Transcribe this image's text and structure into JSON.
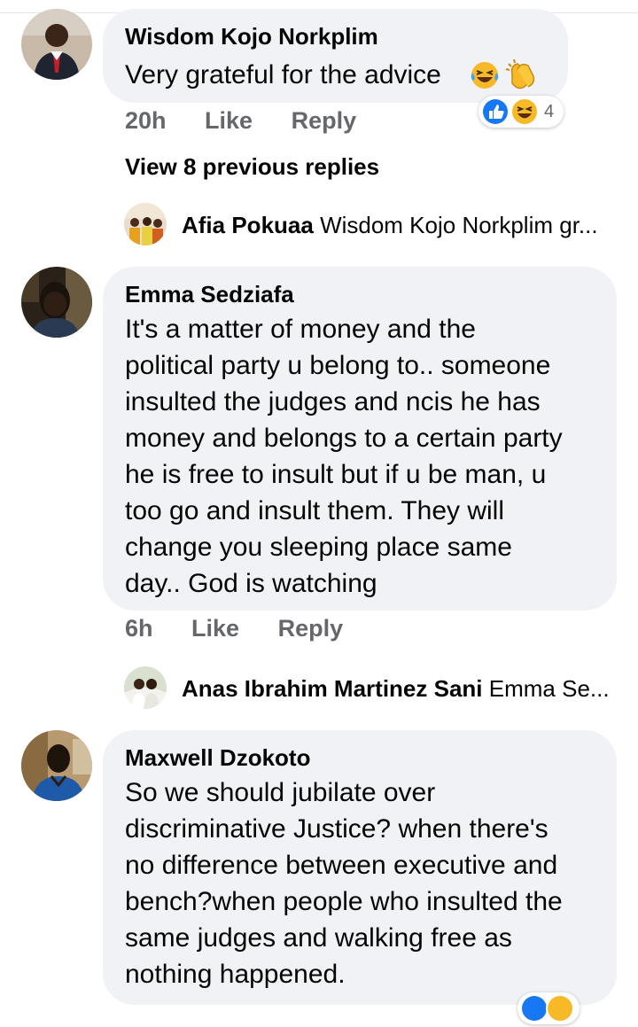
{
  "comments": [
    {
      "author": "Wisdom Kojo Norkplim",
      "text_lines": [
        "Very grateful for the advice"
      ],
      "time": "20h",
      "like": "Like",
      "reply": "Reply",
      "reaction_count": "4",
      "emojis": [
        "laughing-tears",
        "clapping-hands"
      ],
      "reactions": [
        "like",
        "haha"
      ]
    },
    {
      "author": "Emma Sedziafa",
      "text_lines": [
        "It's a matter of money and the",
        "political party u belong to.. someone",
        "insulted the judges and ncis he has",
        "money and belongs to a certain party",
        "he is free to insult but if u be man, u",
        "too go and insult them. They will",
        "change you sleeping place same",
        "day.. God is watching"
      ],
      "time": "6h",
      "like": "Like",
      "reply": "Reply"
    },
    {
      "author": "Maxwell Dzokoto",
      "text_lines": [
        "So we should jubilate over",
        "discriminative Justice? when there's",
        "no difference between executive and",
        "bench?when people who insulted the",
        "same judges and walking free as",
        "nothing happened."
      ]
    }
  ],
  "view_previous": "View 8 previous replies",
  "replies": [
    {
      "name": "Afia Pokuaa",
      "preview": "Wisdom Kojo Norkplim gr..."
    },
    {
      "name": "Anas Ibrahim Martinez Sani",
      "preview": "Emma Se..."
    }
  ],
  "colors": {
    "bubble": "#f0f2f5",
    "meta": "#65676b",
    "like_blue": "#1877f2",
    "haha_yellow": "#f7b928"
  }
}
